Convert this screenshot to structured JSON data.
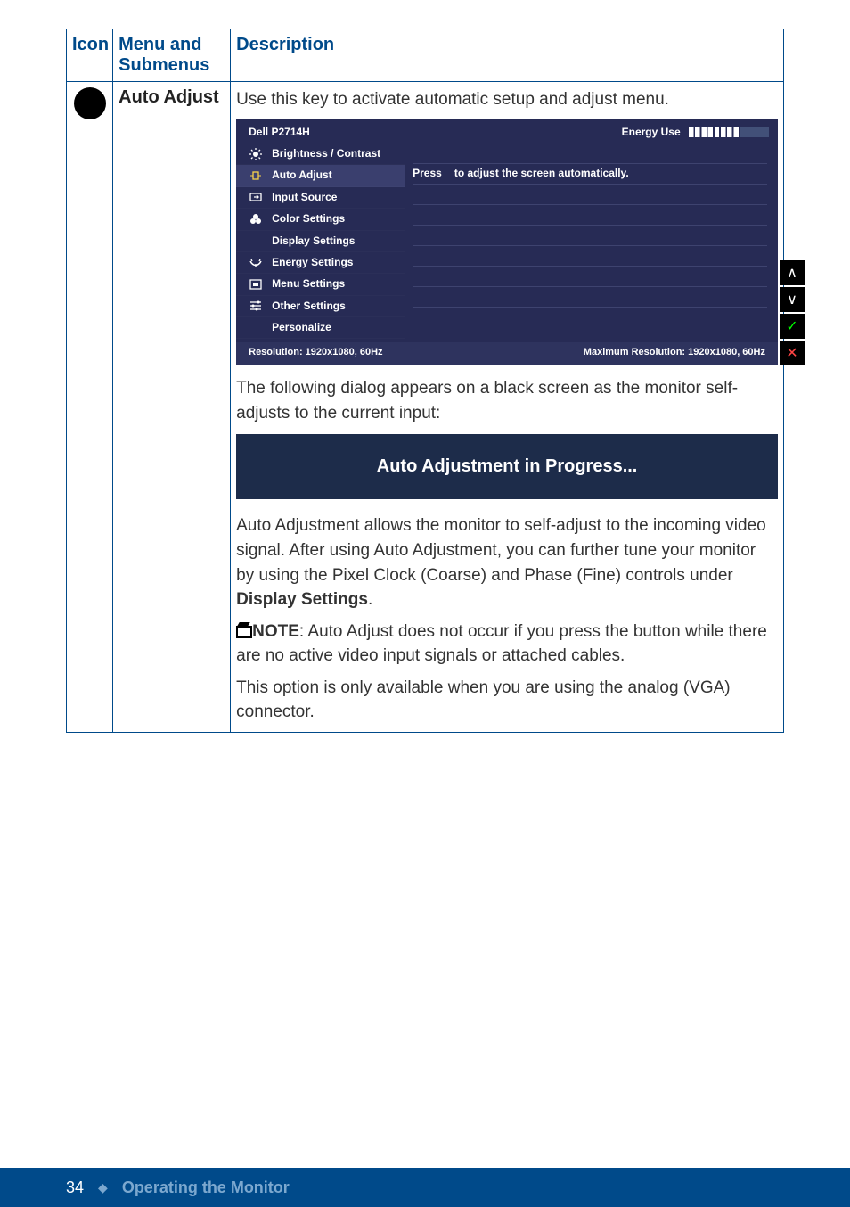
{
  "headers": {
    "icon": "Icon",
    "menu": "Menu and Submenus",
    "desc": "Description"
  },
  "row": {
    "menu_label": "Auto Adjust",
    "intro": "Use this key to activate automatic setup and adjust menu.",
    "para2": "The following dialog appears on a black screen as the monitor self-adjusts to the current input:",
    "progress_banner": "Auto Adjustment in Progress...",
    "para3a": "Auto Adjustment allows the monitor to self-adjust to the incoming video signal. After using Auto Adjustment, you can further tune your monitor by using the Pixel Clock (Coarse) and Phase (Fine) controls under ",
    "para3b": "Display Settings",
    "para3c": ".",
    "note_label": "NOTE",
    "note_body": ": Auto Adjust does not occur if you press the button while there are no active video input signals or attached cables.",
    "para4": "This option is only available when you are using the analog (VGA) connector."
  },
  "osd": {
    "title": "Dell P2714H",
    "energy_label": "Energy Use",
    "menu_items": [
      "Brightness / Contrast",
      "Auto Adjust",
      "Input Source",
      "Color Settings",
      "Display Settings",
      "Energy Settings",
      "Menu Settings",
      "Other Settings",
      "Personalize"
    ],
    "right_press": "Press",
    "right_hint": "to adjust the screen automatically.",
    "res_left": "Resolution: 1920x1080, 60Hz",
    "res_right": "Maximum Resolution: 1920x1080, 60Hz",
    "side_buttons": [
      "∧",
      "∨",
      "✓",
      "✕"
    ]
  },
  "footer": {
    "page_number": "34",
    "section_title": "Operating the Monitor"
  }
}
